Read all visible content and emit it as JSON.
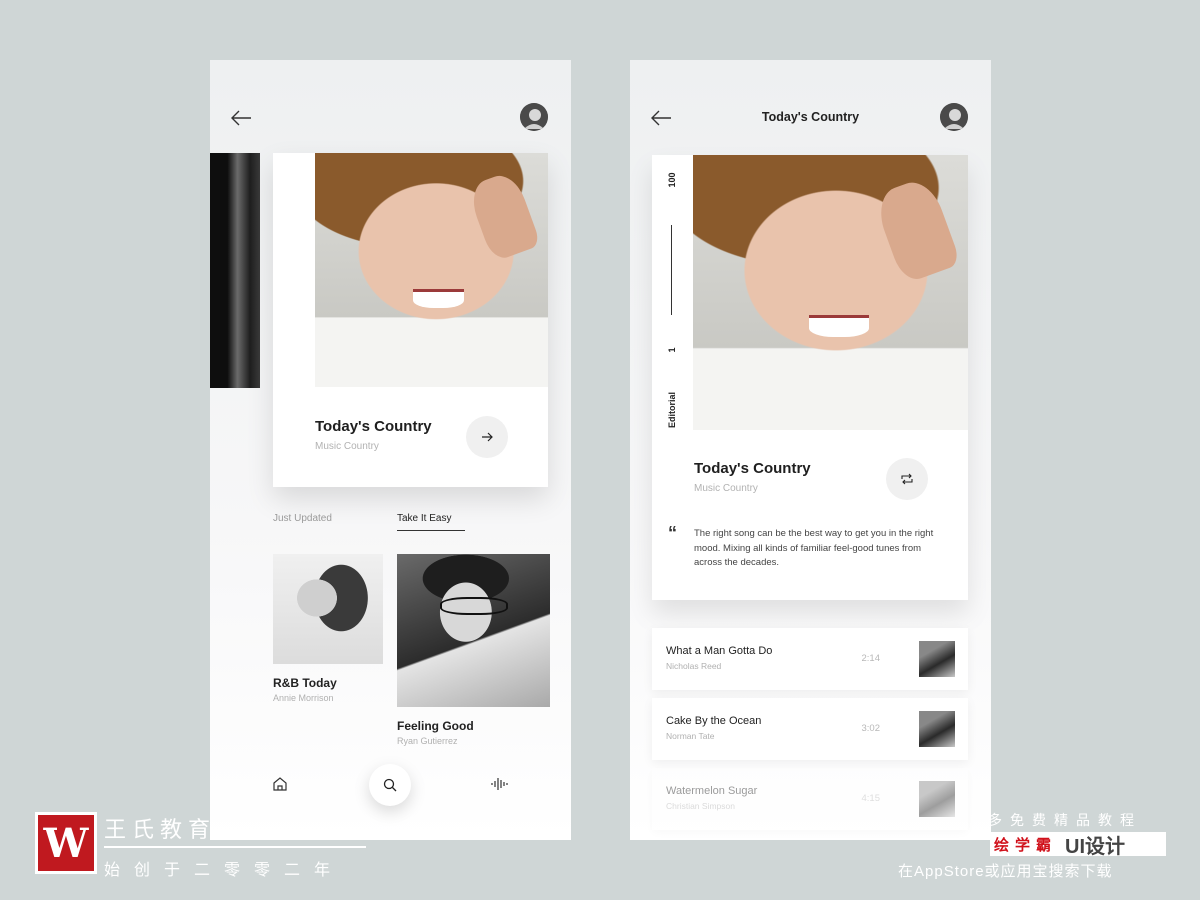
{
  "phone_a": {
    "featured": {
      "title": "Today's Country",
      "subtitle": "Music Country"
    },
    "tabs": [
      "Just Updated",
      "Take It Easy"
    ],
    "items": [
      {
        "title": "R&B Today",
        "artist": "Annie Morrison"
      },
      {
        "title": "Feeling Good",
        "artist": "Ryan Gutierrez"
      }
    ]
  },
  "phone_b": {
    "header_title": "Today's Country",
    "side_labels": {
      "top": "100",
      "bottom": "1",
      "category": "Editorial"
    },
    "title": "Today's Country",
    "subtitle": "Music Country",
    "quote_mark": "“",
    "quote": "The right song can be the best way to get you in the right mood. Mixing all kinds of familiar feel-good tunes from across the decades.",
    "tracks": [
      {
        "title": "What a Man Gotta Do",
        "artist": "Nicholas Reed",
        "duration": "2:14"
      },
      {
        "title": "Cake By the Ocean",
        "artist": "Norman Tate",
        "duration": "3:02"
      },
      {
        "title": "Watermelon Sugar",
        "artist": "Christian Simpson",
        "duration": "4:15"
      }
    ]
  },
  "watermark": {
    "logo_letter": "W",
    "name": "王氏教育",
    "slogan": "始创于二零零二年",
    "right_line1": "多免费精品教程",
    "right_badge": "绘学霸",
    "right_badge2": "UI设计",
    "right_line3": "在AppStore或应用宝搜索下载"
  },
  "colors": {
    "background": "#cfd6d6",
    "brand_red": "#c0191f"
  }
}
